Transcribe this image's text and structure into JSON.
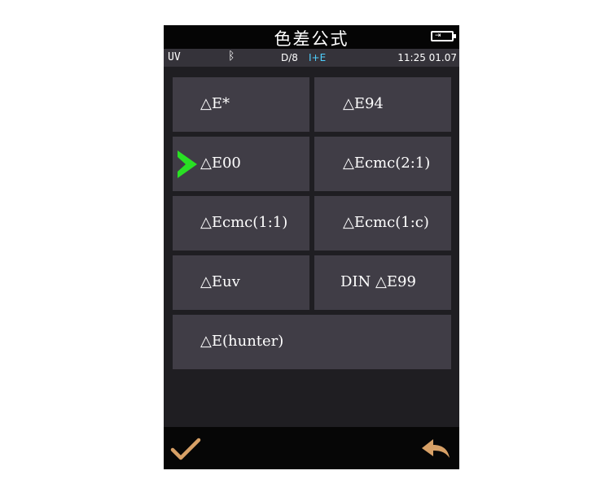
{
  "header": {
    "title": "色差公式"
  },
  "status": {
    "uv": "UV",
    "bluetooth_icon": "bluetooth-icon",
    "geometry": "D/8",
    "mode": "I+E",
    "time": "11:25 01.07",
    "mode_color": "#4fd0ff"
  },
  "formulas": [
    {
      "label": "△E*"
    },
    {
      "label": "△E94"
    },
    {
      "label": "△E00",
      "selected": true
    },
    {
      "label": "△Ecmc(2:1)"
    },
    {
      "label": "△Ecmc(1:1)"
    },
    {
      "label": "△Ecmc(1:c)"
    },
    {
      "label": "△Euv"
    },
    {
      "label": "DIN △E99"
    },
    {
      "label": "△E(hunter)"
    }
  ],
  "footer": {
    "ok_icon": "check-icon",
    "back_icon": "back-arrow-icon"
  },
  "colors": {
    "accent_ok": "#d7a066",
    "selection_arrow": "#29e024",
    "tile": "#403d46"
  }
}
